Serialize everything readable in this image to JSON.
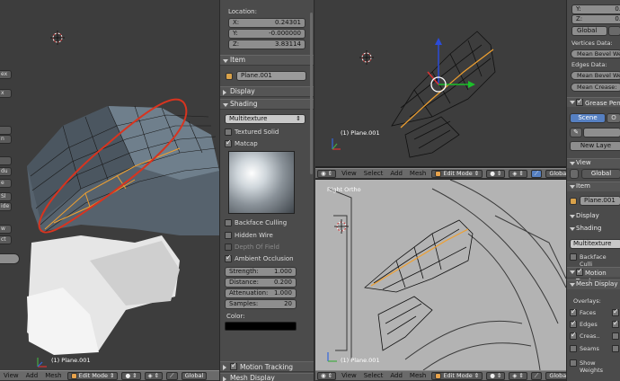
{
  "left_viewport": {
    "tool_tabs": [
      "ex",
      "x",
      "",
      "n",
      "",
      "du",
      "e",
      "Sl",
      "ide",
      "w",
      "ct",
      ""
    ],
    "object_caption": "(1) Plane.001",
    "header": {
      "menus": [
        "View",
        "Add",
        "Mesh"
      ],
      "mode": "Edit Mode",
      "orientation": "Global"
    }
  },
  "properties": {
    "location_label": "Location:",
    "location": [
      {
        "axis": "X:",
        "value": "0.24301"
      },
      {
        "axis": "Y:",
        "value": "-0.000000"
      },
      {
        "axis": "Z:",
        "value": "3.83114"
      }
    ],
    "item_section": "Item",
    "object_name": "Plane.001",
    "display_section": "Display",
    "shading_section": "Shading",
    "shading_mode": "Multitexture",
    "textured_solid": "Textured Solid",
    "matcap": "Matcap",
    "backface_culling": "Backface Culling",
    "hidden_wire": "Hidden Wire",
    "depth_of_field": "Depth Of Field",
    "ambient_occlusion": "Ambient Occlusion",
    "ao_fields": [
      {
        "label": "Strength:",
        "value": "1.000"
      },
      {
        "label": "Distance:",
        "value": "0.200"
      },
      {
        "label": "Attenuation:",
        "value": "1.000"
      },
      {
        "label": "Samples:",
        "value": "20"
      }
    ],
    "color_label": "Color:",
    "motion_tracking": "Motion Tracking",
    "mesh_display": "Mesh Display"
  },
  "top_right_viewport": {
    "object_caption": "(1) Plane.001",
    "header": {
      "menus": [
        "View",
        "Select",
        "Add",
        "Mesh"
      ],
      "mode": "Edit Mode",
      "orientation": "Global"
    }
  },
  "bottom_right_viewport": {
    "view_label": "Right Ortho",
    "object_caption": "(1) Plane.001",
    "header": {
      "menus": [
        "View",
        "Select",
        "Add",
        "Mesh"
      ],
      "mode": "Edit Mode",
      "orientation": "Global"
    }
  },
  "right_panel": {
    "y_label": "Y:",
    "y_value": "0.",
    "z_label": "Z:",
    "z_value": "0.",
    "global_btn": "Global",
    "vertices_data": "Vertices Data:",
    "mean_bevel_weight": "Mean Bevel We",
    "edges_data": "Edges Data:",
    "mean_bevel_weight_2": "Mean Bevel We",
    "mean_crease": "Mean Crease:",
    "grease_pencil": "Grease Pen",
    "scene_tab": "Scene",
    "other_tab": "O",
    "new_layer": "New Laye",
    "view_section": "View",
    "view_orient": "Global",
    "item_section": "Item",
    "object_name": "Plane.001",
    "display_section": "Display",
    "shading_section": "Shading",
    "shading_mode": "Multitexture",
    "backface_culling": "Backface Culli",
    "motion_tracking": "Motion Track",
    "mesh_display": "Mesh Display",
    "overlays": "Overlays:",
    "faces": "Faces",
    "edges": "Edges",
    "creases": "Creas..",
    "seams": "Seams",
    "show_weights": "Show Weights"
  },
  "colors": {
    "selection": "#d8341f",
    "edge_highlight": "#f0a030",
    "active_tab": "#5680c2"
  }
}
